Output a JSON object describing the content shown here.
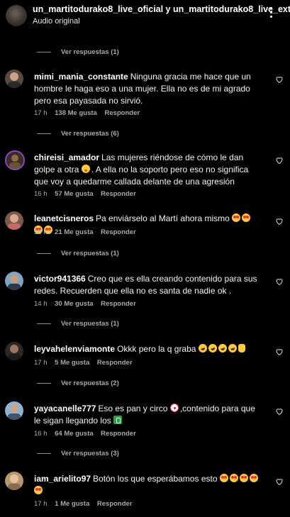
{
  "header": {
    "title": "un_martitodurako8_live_oficial y un_martitodurako8_live_ext",
    "subtitle": "Audio original"
  },
  "comments": [
    {
      "username": "mimi_mania_constante",
      "text": "Ninguna gracia me hace que un hombre le haga eso a una mujer. Ella no es de mi agrado pero esa payasada no sirvió.",
      "emojis": [],
      "time": "17 h",
      "likes": "138 Me gusta",
      "reply": "Responder",
      "replies_before": "Ver respuestas (1)",
      "avatar_color": "#6e5a55"
    },
    {
      "username": "chireisi_amador",
      "text": "Las mujeres riéndose de cómo le dan golpe a otra",
      "text_after_emoji": ". A ella no la soporto pero eso no significa que voy a quedarme callada delante de una agresión",
      "emojis": [
        "shushing-face"
      ],
      "time": "16 h",
      "likes": "57 Me gusta",
      "reply": "Responder",
      "replies_before": "Ver respuestas (6)",
      "avatar_color": "#4f3a6e"
    },
    {
      "username": "leanetcisneros",
      "text": "Pa enviárselo al Martí ahora mismo",
      "emojis": [
        "heart-eyes",
        "heart-eyes",
        "heart-eyes",
        "heart-eyes"
      ],
      "time": "16 h",
      "likes": "21 Me gusta",
      "reply": "Responder",
      "replies_before": "",
      "avatar_color": "#7a5b4a"
    },
    {
      "username": "victor941366",
      "text": "Creo que es ella creando contenido para sus redes. Recuerden que ella no es santa de nadie ok .",
      "emojis": [],
      "time": "14 h",
      "likes": "30 Me gusta",
      "reply": "Responder",
      "replies_before": "Ver respuestas (1)",
      "avatar_color": "#4d6a80"
    },
    {
      "username": "leyvahelenviamonte",
      "text": "Okkk pero la q graba",
      "emojis": [
        "rofl",
        "rofl",
        "rofl",
        "rofl",
        "ok-hand"
      ],
      "time": "17 h",
      "likes": "5 Me gusta",
      "reply": "Responder",
      "replies_before": "Ver respuestas (1)",
      "avatar_color": "#3c3a3a"
    },
    {
      "username": "yayacanelle777",
      "text": "Eso es pan y circo",
      "text_after_emoji": ",contenido para que le sigan llegando los",
      "emojis": [
        "clown-face",
        "money"
      ],
      "time": "16 h",
      "likes": "64 Me gusta",
      "reply": "Responder",
      "replies_before": "Ver respuestas (2)",
      "avatar_color": "#5e7fa0"
    },
    {
      "username": "iam_arielito97",
      "text": "Botón los que esperábamos esto",
      "emojis": [
        "heart-eyes",
        "heart-eyes",
        "heart-eyes",
        "heart-eyes",
        "heart-eyes"
      ],
      "time": "17 h",
      "likes": "1 Me gusta",
      "reply": "Responder",
      "replies_before": "Ver respuestas (3)",
      "avatar_color": "#b09068"
    }
  ],
  "replies_between": {
    "after_leanet": "Ver respuestas (1)"
  },
  "colors": {
    "background": "#000000",
    "text_primary": "#f5f5f5",
    "text_secondary": "#a8a8a8"
  }
}
